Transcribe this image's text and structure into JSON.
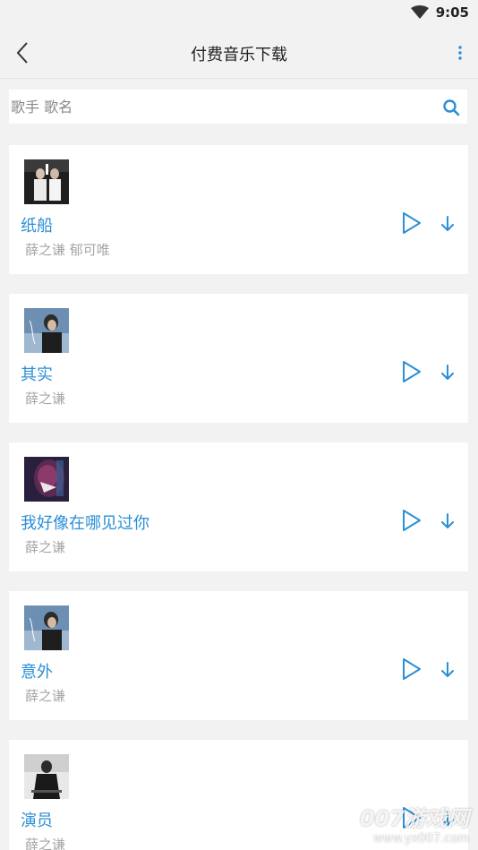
{
  "status": {
    "time": "9:05"
  },
  "header": {
    "title": "付费音乐下载"
  },
  "search": {
    "placeholder": "歌手 歌名"
  },
  "songs": [
    {
      "title": "纸船",
      "artist": "薛之谦 郁可唯"
    },
    {
      "title": "其实",
      "artist": "薛之谦"
    },
    {
      "title": "我好像在哪见过你",
      "artist": "薛之谦"
    },
    {
      "title": "意外",
      "artist": "薛之谦"
    },
    {
      "title": "演员",
      "artist": "薛之谦"
    }
  ],
  "watermark": {
    "main": "007游戏网",
    "url": "www.yx007.com"
  },
  "colors": {
    "accent": "#2a8fd6",
    "background": "#f2f2f2",
    "card": "#ffffff",
    "secondary_text": "#a6a6a6"
  },
  "icons": [
    "wifi-icon",
    "back-arrow-icon",
    "more-vertical-icon",
    "search-icon",
    "play-icon",
    "download-icon"
  ]
}
